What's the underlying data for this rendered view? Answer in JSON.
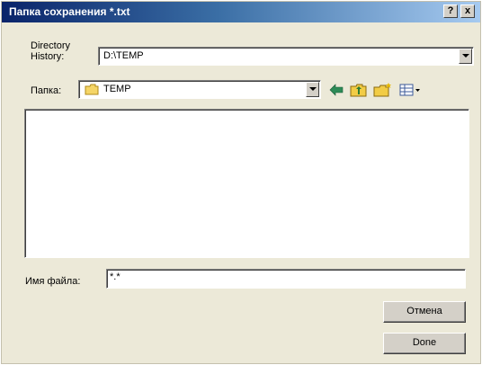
{
  "window": {
    "title": "Папка сохранения *.txt",
    "help_label": "?",
    "close_label": "x"
  },
  "history": {
    "label": "Directory History:",
    "value": "D:\\TEMP"
  },
  "folder": {
    "label": "Папка:",
    "value": "TEMP"
  },
  "filename": {
    "label": "Имя файла:",
    "value": "*.*"
  },
  "buttons": {
    "cancel": "Отмена",
    "done": "Done"
  },
  "icons": {
    "back": "back-arrow-icon",
    "up": "up-folder-icon",
    "new_folder": "new-folder-icon",
    "view": "view-menu-icon"
  }
}
